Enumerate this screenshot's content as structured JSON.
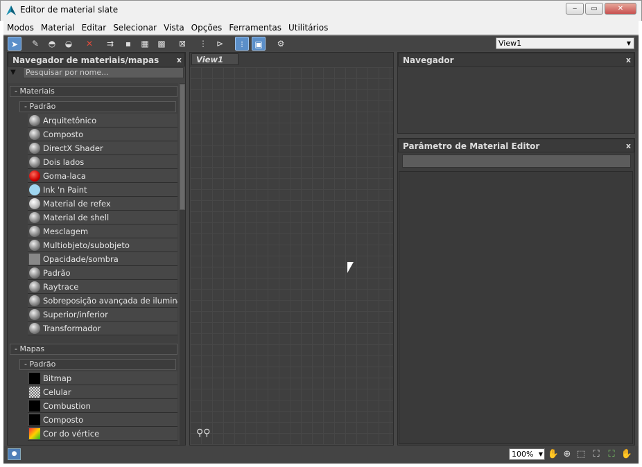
{
  "window": {
    "title": "Editor de material slate",
    "minimize": "‒",
    "maximize": "▭",
    "close": "✕"
  },
  "menu": [
    "Modos",
    "Material",
    "Editar",
    "Selecionar",
    "Vista",
    "Opções",
    "Ferramentas",
    "Utilitários"
  ],
  "toolbar": {
    "view_select": "View1"
  },
  "browser": {
    "title": "Navegador de materiais/mapas",
    "close": "x",
    "search_placeholder": "Pesquisar por nome...",
    "materials_group": "- Materiais",
    "materials_sub": "- Padrão",
    "materials": [
      {
        "label": "Arquitetônico",
        "swatch": "sphere"
      },
      {
        "label": "Composto",
        "swatch": "sphere"
      },
      {
        "label": "DirectX Shader",
        "swatch": "sphere"
      },
      {
        "label": "Dois lados",
        "swatch": "sphere"
      },
      {
        "label": "Goma-laca",
        "swatch": "red"
      },
      {
        "label": "Ink 'n Paint",
        "swatch": "lightblue"
      },
      {
        "label": "Material de refex",
        "swatch": "sphere-white"
      },
      {
        "label": "Material de shell",
        "swatch": "sphere"
      },
      {
        "label": "Mesclagem",
        "swatch": "sphere"
      },
      {
        "label": "Multiobjeto/subobjeto",
        "swatch": "sphere"
      },
      {
        "label": "Opacidade/sombra",
        "swatch": "gray"
      },
      {
        "label": "Padrão",
        "swatch": "sphere"
      },
      {
        "label": "Raytrace",
        "swatch": "sphere"
      },
      {
        "label": "Sobreposição avançada de iluminação",
        "swatch": "sphere"
      },
      {
        "label": "Superior/inferior",
        "swatch": "sphere"
      },
      {
        "label": "Transformador",
        "swatch": "sphere"
      }
    ],
    "maps_group": "- Mapas",
    "maps_sub": "- Padrão",
    "maps": [
      {
        "label": "Bitmap",
        "swatch": "black"
      },
      {
        "label": "Celular",
        "swatch": "noise"
      },
      {
        "label": "Combustion",
        "swatch": "black"
      },
      {
        "label": "Composto",
        "swatch": "black"
      },
      {
        "label": "Cor do vértice",
        "swatch": "gradient"
      }
    ]
  },
  "view": {
    "tab": "View1"
  },
  "navigator": {
    "title": "Navegador",
    "close": "x"
  },
  "params": {
    "title": "Parâmetro de Material Editor",
    "close": "x"
  },
  "status": {
    "zoom": "100%"
  },
  "colors": {
    "panel_bg": "#444444",
    "active_blue": "#5b8fc9"
  }
}
